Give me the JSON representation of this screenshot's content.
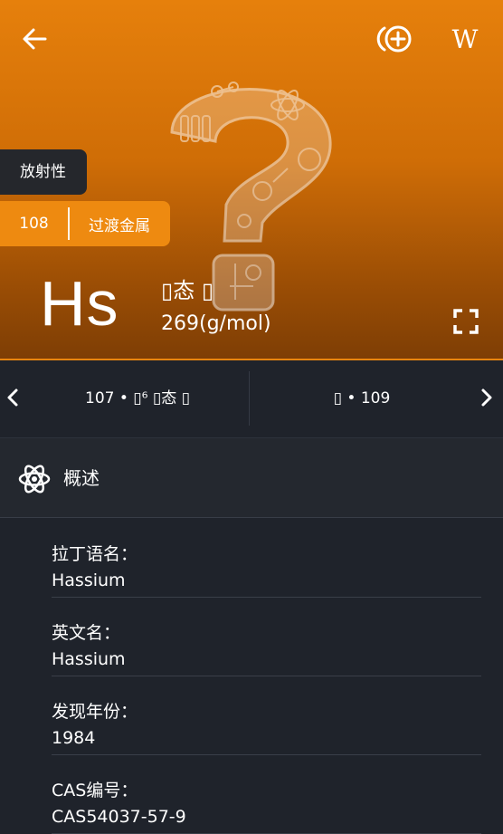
{
  "header": {
    "back_icon": "arrow-left-icon",
    "add_icon": "add-circle-icon",
    "wiki_label": "W"
  },
  "element": {
    "radio_tag": "放射性",
    "atomic_number": "108",
    "category": "过渡金属",
    "symbol": "Hs",
    "state": "▯态 ▯",
    "atomic_mass": "269(g/mol)"
  },
  "nav": {
    "prev_label": "107 • ▯⁶ ▯态 ▯",
    "next_label": "▯ • 109"
  },
  "section": {
    "title": "概述",
    "icon": "atom-icon"
  },
  "info": [
    {
      "label": "拉丁语名：",
      "value": "Hassium"
    },
    {
      "label": "英文名：",
      "value": "Hassium"
    },
    {
      "label": "发现年份：",
      "value": "1984"
    },
    {
      "label": "CAS编号：",
      "value": "CAS54037-57-9"
    }
  ],
  "colors": {
    "accent": "#ee8a10",
    "hero_top": "#e6800c",
    "hero_bottom": "#7e3e05",
    "background": "#1f232b",
    "panel": "#24282f",
    "tag_dark": "#25272c"
  }
}
